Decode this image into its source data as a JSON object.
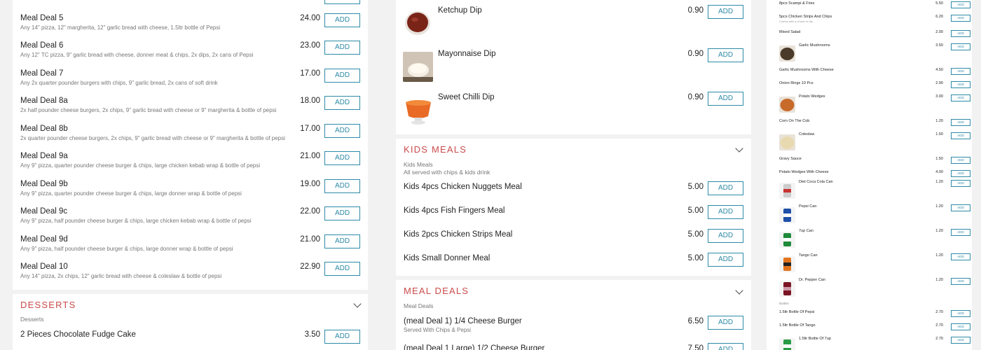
{
  "left": {
    "deals": [
      {
        "name": "Meal Deal 5",
        "desc": "Any 14\" pizza, 12\" margherita, 12\" garlic bread with cheese, 1.5ltr bottle of Pepsi",
        "price": "24.00"
      },
      {
        "name": "Meal Deal 6",
        "desc": "Any 12\" TC pizza, 9\" garlic bread with cheese, donner meat & chips, 2x dips, 2x cans of Pepsi",
        "price": "23.00"
      },
      {
        "name": "Meal Deal 7",
        "desc": "Any 2x quarter pounder burgers with chips, 9\" garlic bread, 2x cans of soft drink",
        "price": "17.00"
      },
      {
        "name": "Meal Deal 8a",
        "desc": "2x half pounder cheese burgers, 2x chips, 9\" garlic bread with cheese or 9\" margherita & bottle of pepsi",
        "price": "18.00"
      },
      {
        "name": "Meal Deal 8b",
        "desc": "2x quarter pounder cheese burgers, 2x chips, 9\" garlic bread with cheese or 9\" margherita & bottle of pepsi",
        "price": "17.00"
      },
      {
        "name": "Meal Deal 9a",
        "desc": "Any 9\" pizza, quarter pounder cheese burger & chips, large chicken kebab wrap & bottle of pepsi",
        "price": "21.00"
      },
      {
        "name": "Meal Deal 9b",
        "desc": "Any 9\" pizza, quarter pounder cheese burger & chips, large donner wrap & bottle of pepsi",
        "price": "19.00"
      },
      {
        "name": "Meal Deal 9c",
        "desc": "Any 9\" pizza, half pounder cheese burger & chips, large chicken kebab wrap & bottle of pepsi",
        "price": "22.00"
      },
      {
        "name": "Meal Deal 9d",
        "desc": "Any 9\" pizza, half pounder cheese burger & chips, large donner wrap & bottle of pepsi",
        "price": "21.00"
      },
      {
        "name": "Meal Deal 10",
        "desc": "Any 14\" pizza, 2x chips, 12\" garlic bread with cheese & coleslaw & bottle of pepsi",
        "price": "22.90"
      }
    ],
    "desserts": {
      "title": "DESSERTS",
      "subtitle": "Desserts",
      "items": [
        {
          "name": "2 Pieces Chocolate Fudge Cake",
          "price": "3.50"
        }
      ]
    }
  },
  "add_label": "ADD",
  "middle": {
    "dips": [
      {
        "name": "Ketchup Dip",
        "price": "0.90"
      },
      {
        "name": "Mayonnaise Dip",
        "price": "0.90"
      },
      {
        "name": "Sweet Chilli Dip",
        "price": "0.90"
      }
    ],
    "kids": {
      "title": "KIDS MEALS",
      "subtitle": "Kids Meals",
      "note": "All served with chips & kids drink",
      "items": [
        {
          "name": "Kids 4pcs Chicken Nuggets Meal",
          "price": "5.00"
        },
        {
          "name": "Kids 4pcs Fish Fingers Meal",
          "price": "5.00"
        },
        {
          "name": "Kids 2pcs Chicken Strips Meal",
          "price": "5.00"
        },
        {
          "name": "Kids Small Donner Meal",
          "price": "5.00"
        }
      ]
    },
    "meal_deals": {
      "title": "MEAL DEALS",
      "subtitle": "Meal Deals",
      "items": [
        {
          "name": "(meal Deal 1) 1/4 Cheese Burger",
          "desc": "Served With Chips & Pepsi",
          "price": "6.50"
        },
        {
          "name": "(meal Deal 1 Large) 1/2 Cheese Burger",
          "desc": "",
          "price": "7.50"
        }
      ]
    }
  },
  "right": {
    "sides": [
      {
        "name": "8pcs Scampi & Fries",
        "price": "5.50"
      },
      {
        "name": "5pcs Chicken Strips And Chips",
        "desc": "Comes with a choice of dip",
        "price": "6.20"
      },
      {
        "name": "Mixed Salad",
        "price": "2.00"
      },
      {
        "name": "Garlic Mushrooms",
        "price": "3.50"
      },
      {
        "name": "Garlic Mushrooms With Cheese",
        "price": "4.50"
      },
      {
        "name": "Onion Rings 10 Pcs",
        "price": "2.90"
      },
      {
        "name": "Potato Wedges",
        "price": "3.00"
      },
      {
        "name": "Corn On The Cob",
        "price": "1.20"
      },
      {
        "name": "Coleslaw",
        "price": "1.50"
      },
      {
        "name": "Gravy Sauce",
        "price": "1.50"
      },
      {
        "name": "Potato Wedges With Cheese",
        "price": "4.00"
      }
    ],
    "drinks": [
      {
        "name": "Diet Coca Cola Can",
        "price": "1.20"
      },
      {
        "name": "Pepsi Can",
        "price": "1.20"
      },
      {
        "name": "7up Can",
        "price": "1.20"
      },
      {
        "name": "Tango Can",
        "price": "1.20"
      },
      {
        "name": "Dr. Pepper Can",
        "price": "1.20"
      }
    ],
    "bottles_label": "Bottles",
    "bottles": [
      {
        "name": "1.5ltr Bottle Of Pepsi",
        "price": "2.70"
      },
      {
        "name": "1.5ltr Bottle Of Tango",
        "price": "2.70"
      },
      {
        "name": "1.5ltr Bottle Of 7up",
        "price": "2.70"
      }
    ]
  }
}
